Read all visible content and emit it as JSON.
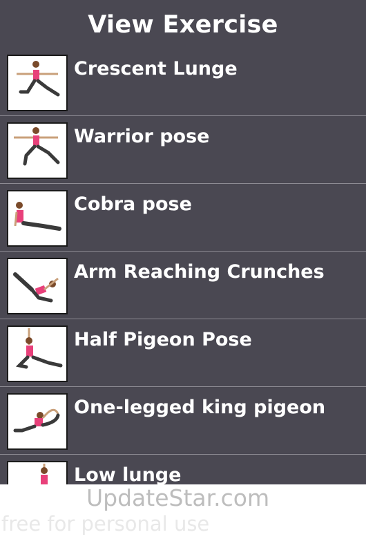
{
  "header": {
    "title": "View Exercise"
  },
  "exercises": [
    {
      "name": "Crescent Lunge",
      "icon": "crescent-lunge-icon"
    },
    {
      "name": "Warrior pose",
      "icon": "warrior-pose-icon"
    },
    {
      "name": "Cobra pose",
      "icon": "cobra-pose-icon"
    },
    {
      "name": "Arm Reaching Crunches",
      "icon": "arm-reaching-crunches-icon"
    },
    {
      "name": "Half Pigeon Pose",
      "icon": "half-pigeon-pose-icon"
    },
    {
      "name": "One-legged king pigeon",
      "icon": "one-legged-king-pigeon-icon"
    },
    {
      "name": "Low lunge",
      "icon": "low-lunge-icon"
    }
  ],
  "watermark": {
    "brand": "UpdateStar.com",
    "note": "free for personal use"
  },
  "colors": {
    "background": "#4a4852",
    "text": "#ffffff",
    "accent": "#e8407a",
    "legs": "#3a3a3a"
  }
}
